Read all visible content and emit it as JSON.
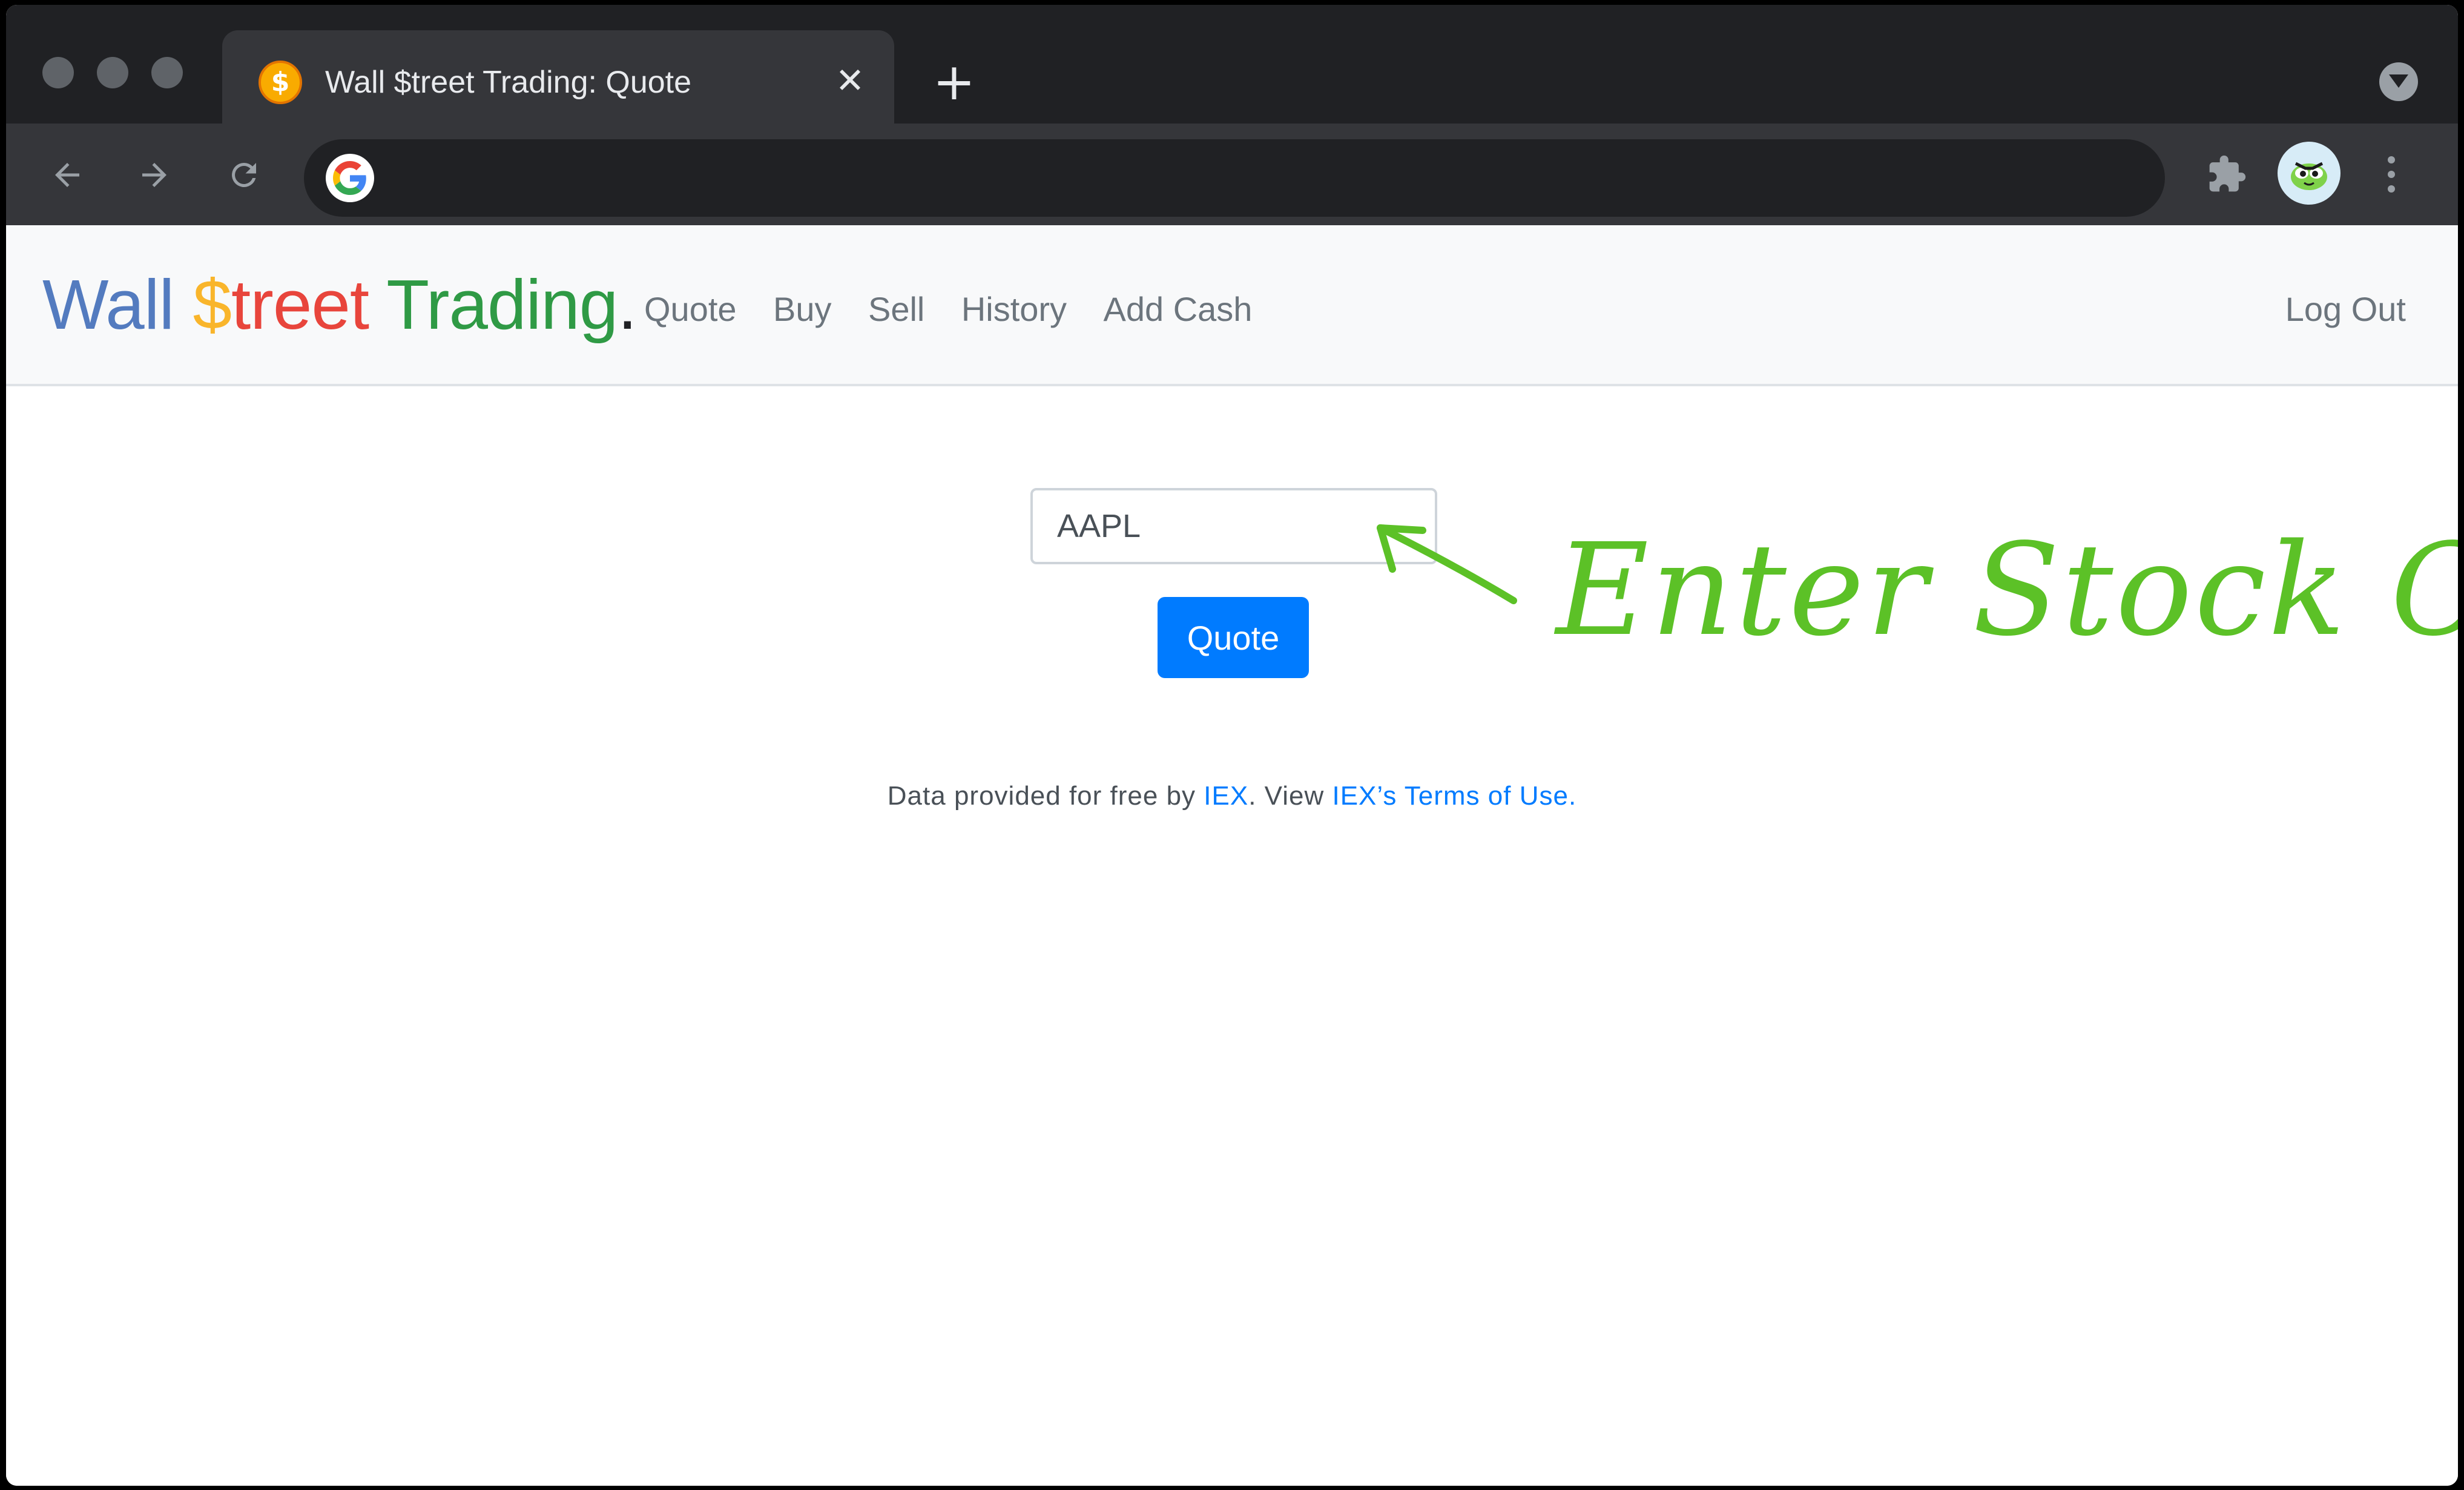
{
  "browser": {
    "tab_title": "Wall $treet Trading: Quote",
    "favicon_glyph": "$",
    "close_glyph": "✕",
    "new_tab_glyph": "+",
    "address_value": "",
    "colors": {
      "tabstrip": "#202124",
      "toolbar": "#35363a",
      "omnibox": "#202124"
    }
  },
  "brand": {
    "part1": "Wall",
    "part2_dollar": "$",
    "part2_rest": "treet",
    "part3": "Trading",
    "dot": ".",
    "colors": {
      "wall": "#537bbf",
      "dollar": "#f9b52b",
      "treet": "#e8453c",
      "trading": "#2f9a45",
      "dot": "#202124"
    }
  },
  "nav": {
    "links": [
      "Quote",
      "Buy",
      "Sell",
      "History",
      "Add Cash"
    ],
    "logout": "Log Out"
  },
  "form": {
    "symbol_value": "AAPL",
    "quote_button": "Quote",
    "accent_color": "#007bff"
  },
  "attribution": {
    "prefix": "Data provided for free by",
    "iex_link": "IEX",
    "middle": ". View",
    "terms_link": "IEX’s Terms of Use",
    "suffix": "."
  },
  "annotation": {
    "text": "Enter Stock Code",
    "color": "#5cc127"
  },
  "icons": [
    "back-arrow-icon",
    "forward-arrow-icon",
    "reload-icon",
    "google-g-icon",
    "puzzle-extensions-icon",
    "profile-avatar-icon",
    "kebab-menu-icon",
    "tab-search-icon",
    "annotation-arrow-icon"
  ]
}
